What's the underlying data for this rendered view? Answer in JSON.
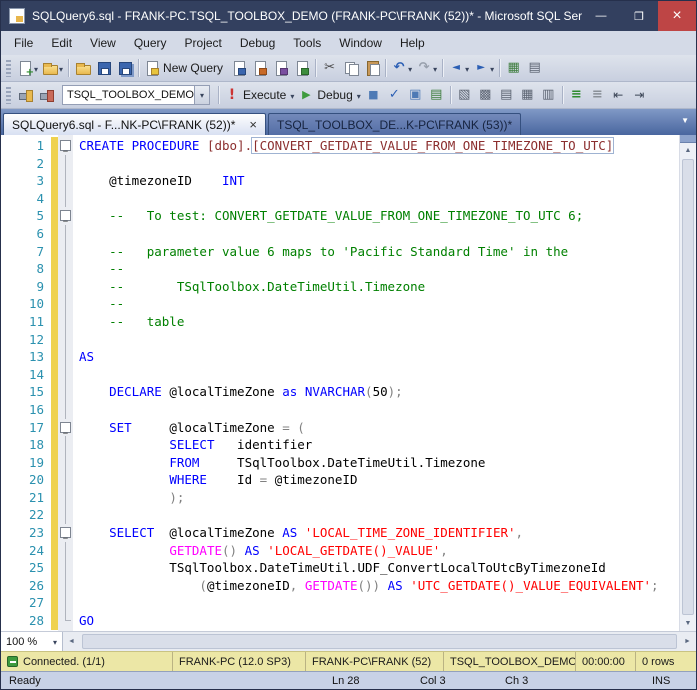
{
  "window": {
    "title": "SQLQuery6.sql - FRANK-PC.TSQL_TOOLBOX_DEMO (FRANK-PC\\FRANK (52))* - Microsoft SQL Ser..."
  },
  "menu": {
    "items": [
      "File",
      "Edit",
      "View",
      "Query",
      "Project",
      "Debug",
      "Tools",
      "Window",
      "Help"
    ]
  },
  "toolbar_main": {
    "items": [
      {
        "name": "new-query-menu",
        "icon": "page-plus",
        "dd": true
      },
      {
        "name": "open-menu",
        "icon": "folder-open",
        "dd": true
      },
      {
        "sep": true
      },
      {
        "name": "open-file",
        "icon": "folder"
      },
      {
        "name": "save",
        "icon": "floppy"
      },
      {
        "name": "save-all",
        "icon": "floppy-multi"
      },
      {
        "sep": true
      },
      {
        "name": "new-query",
        "icon": "page-sql",
        "label": "New Query"
      },
      {
        "name": "new-database-engine-query",
        "icon": "page-db"
      },
      {
        "name": "new-analysis-mdx-query",
        "icon": "page-cube"
      },
      {
        "name": "new-analysis-dmx-query",
        "icon": "page-mine"
      },
      {
        "name": "new-analysis-xmla-query",
        "icon": "page-xml"
      },
      {
        "sep": true
      },
      {
        "name": "cut",
        "icon": "scissors"
      },
      {
        "name": "copy",
        "icon": "copy"
      },
      {
        "name": "paste",
        "icon": "paste"
      },
      {
        "sep": true
      },
      {
        "name": "undo",
        "icon": "undo",
        "dd": true
      },
      {
        "name": "redo",
        "icon": "redo",
        "dd": true
      },
      {
        "sep": true
      },
      {
        "name": "navigate-backward",
        "icon": "nav-back",
        "dd": true
      },
      {
        "name": "navigate-forward",
        "icon": "nav-fwd",
        "dd": true
      },
      {
        "sep": true
      },
      {
        "name": "activity-monitor",
        "icon": "activity"
      },
      {
        "name": "properties-window",
        "icon": "grid-props"
      }
    ]
  },
  "toolbar_sql": {
    "left_items": [
      {
        "name": "connect",
        "icon": "connect"
      },
      {
        "name": "change-connection",
        "icon": "disconnect"
      }
    ],
    "database": "TSQL_TOOLBOX_DEMO",
    "execute_label": "Execute",
    "debug_label": "Debug",
    "right_items": [
      {
        "name": "cancel-executing-query",
        "icon": "stop"
      },
      {
        "name": "parse",
        "icon": "check"
      },
      {
        "name": "intellisense-enabled",
        "icon": "intellisense"
      },
      {
        "name": "include-actual-execution-plan",
        "icon": "plan"
      },
      {
        "sep": true
      },
      {
        "name": "specify-template-values",
        "icon": "braces"
      },
      {
        "name": "query-options",
        "icon": "gear-grid"
      },
      {
        "name": "results-to-text",
        "icon": "res-text"
      },
      {
        "name": "results-to-grid",
        "icon": "res-grid"
      },
      {
        "name": "results-to-file",
        "icon": "res-file"
      },
      {
        "sep": true
      },
      {
        "name": "comment-selection",
        "icon": "comment"
      },
      {
        "name": "uncomment-selection",
        "icon": "uncomment"
      },
      {
        "name": "decrease-indent",
        "icon": "outdent"
      },
      {
        "name": "increase-indent",
        "icon": "indent"
      }
    ]
  },
  "tabs": [
    {
      "label": "SQLQuery6.sql - F...NK-PC\\FRANK (52))*",
      "active": true
    },
    {
      "label": "TSQL_TOOLBOX_DE...K-PC\\FRANK (53))*",
      "active": false
    }
  ],
  "editor": {
    "colors": {
      "keyword": "#0000FF",
      "comment": "#008000",
      "string": "#FF0000",
      "system_function": "#FF00FF",
      "operator": "#808080",
      "identifier": "#000000",
      "object_name": "#8B2E2E",
      "line_number": "#2B91AF",
      "change_bar": "#EFD24F"
    },
    "lines": [
      {
        "n": 1,
        "f": "m",
        "s": [
          [
            "k",
            "CREATE PROCEDURE "
          ],
          [
            "d",
            "[dbo]."
          ],
          [
            "dx",
            "[CONVERT_GETDATE_VALUE_FROM_ONE_TIMEZONE_TO_UTC]"
          ]
        ]
      },
      {
        "n": 2,
        "f": "l",
        "s": []
      },
      {
        "n": 3,
        "f": "l",
        "s": [
          [
            "t",
            "    @timezoneID    "
          ],
          [
            "k",
            "INT"
          ]
        ]
      },
      {
        "n": 4,
        "f": "l",
        "s": []
      },
      {
        "n": 5,
        "f": "m",
        "s": [
          [
            "c",
            "    --   To test: CONVERT_GETDATE_VALUE_FROM_ONE_TIMEZONE_TO_UTC 6;"
          ]
        ]
      },
      {
        "n": 6,
        "f": "l",
        "s": []
      },
      {
        "n": 7,
        "f": "l",
        "s": [
          [
            "c",
            "    --   parameter value 6 maps to 'Pacific Standard Time' in the"
          ]
        ]
      },
      {
        "n": 8,
        "f": "l",
        "s": [
          [
            "c",
            "    --"
          ]
        ]
      },
      {
        "n": 9,
        "f": "l",
        "s": [
          [
            "c",
            "    --       TSqlToolbox.DateTimeUtil.Timezone"
          ]
        ]
      },
      {
        "n": 10,
        "f": "l",
        "s": [
          [
            "c",
            "    --"
          ]
        ]
      },
      {
        "n": 11,
        "f": "l",
        "s": [
          [
            "c",
            "    --   table"
          ]
        ]
      },
      {
        "n": 12,
        "f": "l",
        "s": []
      },
      {
        "n": 13,
        "f": "l",
        "s": [
          [
            "k",
            "AS"
          ]
        ]
      },
      {
        "n": 14,
        "f": "l",
        "s": []
      },
      {
        "n": 15,
        "f": "l",
        "s": [
          [
            "t",
            "    "
          ],
          [
            "k",
            "DECLARE"
          ],
          [
            "t",
            " @localTimeZone "
          ],
          [
            "k",
            "as"
          ],
          [
            "t",
            " "
          ],
          [
            "k",
            "NVARCHAR"
          ],
          [
            "o",
            "("
          ],
          [
            "t",
            "50"
          ],
          [
            "o",
            ");"
          ]
        ]
      },
      {
        "n": 16,
        "f": "l",
        "s": []
      },
      {
        "n": 17,
        "f": "m",
        "s": [
          [
            "t",
            "    "
          ],
          [
            "k",
            "SET"
          ],
          [
            "t",
            "     @localTimeZone "
          ],
          [
            "o",
            "= ("
          ]
        ]
      },
      {
        "n": 18,
        "f": "l",
        "s": [
          [
            "t",
            "            "
          ],
          [
            "k",
            "SELECT"
          ],
          [
            "t",
            "   identifier"
          ]
        ]
      },
      {
        "n": 19,
        "f": "l",
        "s": [
          [
            "t",
            "            "
          ],
          [
            "k",
            "FROM"
          ],
          [
            "t",
            "     TSqlToolbox.DateTimeUtil.Timezone"
          ]
        ]
      },
      {
        "n": 20,
        "f": "l",
        "s": [
          [
            "t",
            "            "
          ],
          [
            "k",
            "WHERE"
          ],
          [
            "t",
            "    Id "
          ],
          [
            "o",
            "="
          ],
          [
            "t",
            " @timezoneID"
          ]
        ]
      },
      {
        "n": 21,
        "f": "l",
        "s": [
          [
            "t",
            "            "
          ],
          [
            "o",
            ");"
          ]
        ]
      },
      {
        "n": 22,
        "f": "l",
        "s": []
      },
      {
        "n": 23,
        "f": "m",
        "s": [
          [
            "t",
            "    "
          ],
          [
            "k",
            "SELECT"
          ],
          [
            "t",
            "  @localTimeZone "
          ],
          [
            "k",
            "AS"
          ],
          [
            "t",
            " "
          ],
          [
            "s",
            "'LOCAL_TIME_ZONE_IDENTIFIER'"
          ],
          [
            "o",
            ","
          ]
        ]
      },
      {
        "n": 24,
        "f": "l",
        "s": [
          [
            "t",
            "            "
          ],
          [
            "f",
            "GETDATE"
          ],
          [
            "o",
            "()"
          ],
          [
            "t",
            " "
          ],
          [
            "k",
            "AS"
          ],
          [
            "t",
            " "
          ],
          [
            "s",
            "'LOCAL_GETDATE()_VALUE'"
          ],
          [
            "o",
            ","
          ]
        ]
      },
      {
        "n": 25,
        "f": "l",
        "s": [
          [
            "t",
            "            TSqlToolbox.DateTimeUtil.UDF_ConvertLocalToUtcByTimezoneId"
          ]
        ]
      },
      {
        "n": 26,
        "f": "l",
        "s": [
          [
            "t",
            "                "
          ],
          [
            "o",
            "("
          ],
          [
            "t",
            "@timezoneID"
          ],
          [
            "o",
            ","
          ],
          [
            "t",
            " "
          ],
          [
            "f",
            "GETDATE"
          ],
          [
            "o",
            "())"
          ],
          [
            "t",
            " "
          ],
          [
            "k",
            "AS"
          ],
          [
            "t",
            " "
          ],
          [
            "s",
            "'UTC_GETDATE()_VALUE_EQUIVALENT'"
          ],
          [
            "o",
            ";"
          ]
        ]
      },
      {
        "n": 27,
        "f": "l",
        "s": []
      },
      {
        "n": 28,
        "f": "e",
        "s": [
          [
            "k",
            "GO"
          ]
        ]
      }
    ]
  },
  "zoom": {
    "level": "100 %"
  },
  "connection_bar": {
    "segments": [
      {
        "name": "connection-status",
        "label": "Connected. (1/1)"
      },
      {
        "name": "server-name-version",
        "label": "FRANK-PC (12.0 SP3)"
      },
      {
        "name": "login-name",
        "label": "FRANK-PC\\FRANK (52)"
      },
      {
        "name": "database-name",
        "label": "TSQL_TOOLBOX_DEMO"
      },
      {
        "name": "elapsed-time",
        "label": "00:00:00"
      },
      {
        "name": "row-count",
        "label": "0 rows"
      }
    ]
  },
  "status_bar": {
    "state": "Ready",
    "line": "Ln 28",
    "col": "Col 3",
    "ch": "Ch 3",
    "mode": "INS"
  }
}
